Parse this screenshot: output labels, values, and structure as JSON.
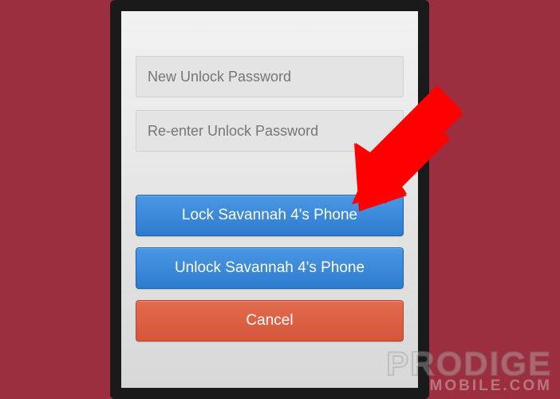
{
  "inputs": {
    "new_password": {
      "placeholder": "New Unlock Password",
      "value": ""
    },
    "reenter_password": {
      "placeholder": "Re-enter Unlock Password",
      "value": ""
    }
  },
  "buttons": {
    "lock": "Lock Savannah 4's Phone",
    "unlock": "Unlock Savannah 4's Phone",
    "cancel": "Cancel"
  },
  "watermark": {
    "line1": "PRODIGE",
    "line2": "MOBILE.COM"
  },
  "colors": {
    "page_bg": "#9b2f3f",
    "btn_primary": "#3a86d8",
    "btn_danger": "#dc5f44",
    "arrow": "#ff0000"
  }
}
